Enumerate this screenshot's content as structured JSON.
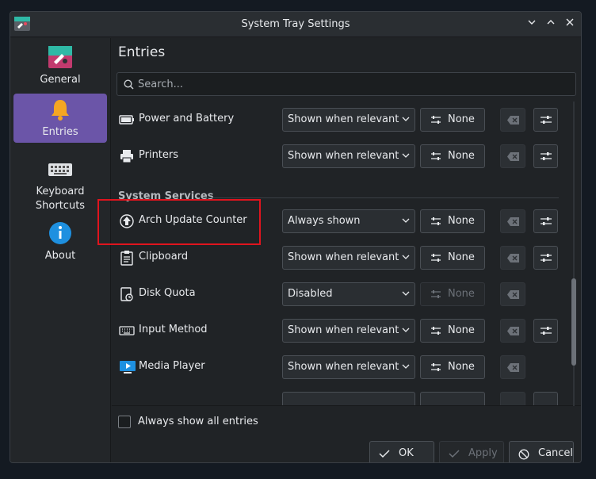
{
  "window": {
    "title": "System Tray Settings",
    "buttons": [
      "minimize",
      "maximize",
      "close"
    ]
  },
  "sidebar": {
    "items": [
      {
        "label": "General",
        "icon": "general-settings-icon",
        "active": false
      },
      {
        "label": "Entries",
        "icon": "bell-icon",
        "active": true
      },
      {
        "label": "Keyboard\nShortcuts",
        "icon": "keyboard-icon",
        "active": false
      },
      {
        "label": "About",
        "icon": "info-icon",
        "active": false
      }
    ]
  },
  "main": {
    "title": "Entries",
    "search_placeholder": "Search..."
  },
  "entries_top": [
    {
      "label": "Power and Battery",
      "icon": "battery-icon",
      "visibility": "Shown when relevant",
      "shortcut": "None",
      "shortcut_enabled": true,
      "configurable": true
    },
    {
      "label": "Printers",
      "icon": "printer-icon",
      "visibility": "Shown when relevant",
      "shortcut": "None",
      "shortcut_enabled": true,
      "configurable": true
    }
  ],
  "section": {
    "label": "System Services"
  },
  "entries_services": [
    {
      "label": "Arch Update Counter",
      "icon": "update-arrow-icon",
      "visibility": "Always shown",
      "shortcut": "None",
      "shortcut_enabled": true,
      "configurable": true
    },
    {
      "label": "Clipboard",
      "icon": "clipboard-icon",
      "visibility": "Shown when relevant",
      "shortcut": "None",
      "shortcut_enabled": true,
      "configurable": true
    },
    {
      "label": "Disk Quota",
      "icon": "disk-quota-icon",
      "visibility": "Disabled",
      "shortcut": "None",
      "shortcut_enabled": false,
      "configurable": false
    },
    {
      "label": "Input Method",
      "icon": "keyboard-icon",
      "visibility": "Shown when relevant",
      "shortcut": "None",
      "shortcut_enabled": true,
      "configurable": true
    },
    {
      "label": "Media Player",
      "icon": "media-player-icon",
      "visibility": "Shown when relevant",
      "shortcut": "None",
      "shortcut_enabled": true,
      "configurable": false
    }
  ],
  "footer": {
    "always_show_all_label": "Always show all entries",
    "always_show_all_checked": false,
    "ok_label": "OK",
    "apply_label": "Apply",
    "apply_enabled": false,
    "cancel_label": "Cancel"
  },
  "colors": {
    "accent": "#6b55a8",
    "highlight_box": "#e0141e",
    "background": "#202326"
  }
}
